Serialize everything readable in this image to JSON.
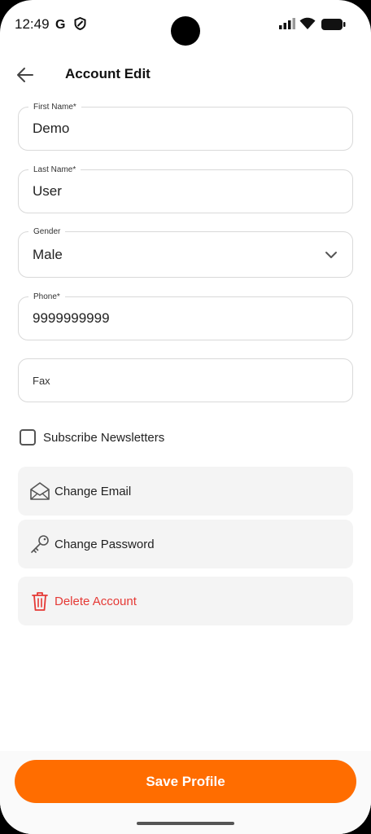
{
  "status_bar": {
    "time": "12:49",
    "left_icons": [
      "google-g-icon",
      "shield-icon"
    ],
    "right_icons": [
      "signal-icon",
      "wifi-icon",
      "battery-icon"
    ]
  },
  "header": {
    "title": "Account Edit",
    "back_icon": "arrow-left-icon"
  },
  "form": {
    "first_name": {
      "label": "First Name*",
      "value": "Demo"
    },
    "last_name": {
      "label": "Last Name*",
      "value": "User"
    },
    "gender": {
      "label": "Gender",
      "value": "Male"
    },
    "phone": {
      "label": "Phone*",
      "value": "9999999999"
    },
    "fax": {
      "placeholder": "Fax"
    },
    "newsletter": {
      "label": "Subscribe Newsletters",
      "checked": false
    }
  },
  "actions": {
    "change_email": {
      "label": "Change Email",
      "icon": "envelope-open-icon"
    },
    "change_password": {
      "label": "Change Password",
      "icon": "key-icon"
    },
    "delete_account": {
      "label": "Delete Account",
      "icon": "trash-icon"
    }
  },
  "footer": {
    "save_label": "Save Profile"
  },
  "colors": {
    "accent": "#ff6d00",
    "danger": "#e53935",
    "border": "#d9d9d9",
    "card_bg": "#f4f4f4"
  }
}
